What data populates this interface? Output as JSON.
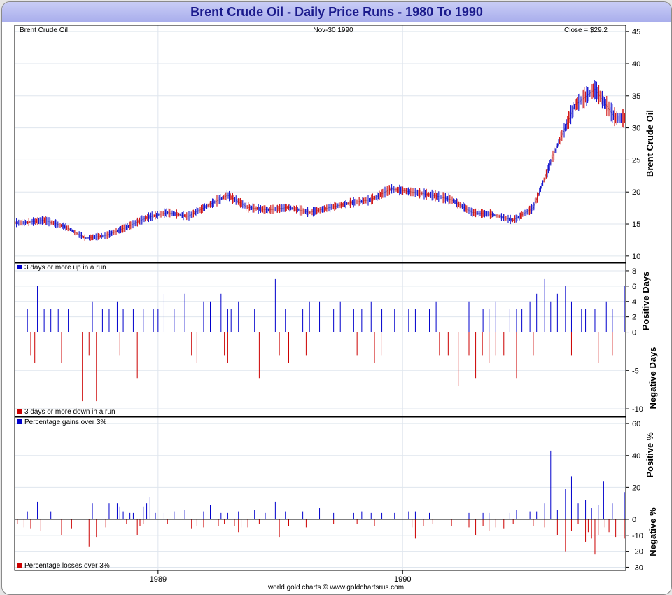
{
  "title": "Brent Crude Oil - Daily Price Runs - 1980 To 1990",
  "credit": "world gold charts © www.goldchartsrus.com",
  "colors": {
    "up": "#0000cc",
    "down": "#cc0000",
    "grid": "#dfe6ee"
  },
  "chart_data": [
    {
      "type": "line",
      "panel": "price",
      "header_left": "Brent Crude Oil",
      "header_center": "Nov-30  1990",
      "header_right": "Close = $29.2",
      "ylabel": "Brent Crude Oil",
      "ylim": [
        9,
        46
      ],
      "yticks": [
        "10",
        "15",
        "20",
        "25",
        "30",
        "35",
        "40",
        "45"
      ],
      "xticks": [
        "1989",
        "1990"
      ],
      "x_start": "1988-06-01",
      "x_end": "1990-11-30",
      "series": [
        {
          "x": [
            "1988-06",
            "1988-07",
            "1988-08",
            "1988-09",
            "1988-10",
            "1988-11",
            "1988-12",
            "1989-01",
            "1989-02",
            "1989-03",
            "1989-04",
            "1989-05",
            "1989-06",
            "1989-07",
            "1989-08",
            "1989-09",
            "1989-10",
            "1989-11",
            "1989-12",
            "1990-01",
            "1990-02",
            "1990-03",
            "1990-04",
            "1990-05",
            "1990-06",
            "1990-07",
            "1990-08",
            "1990-09",
            "1990-10",
            "1990-11"
          ],
          "values": [
            15.2,
            15.6,
            14.6,
            12.8,
            13.2,
            14.5,
            16.0,
            16.8,
            16.2,
            17.8,
            19.5,
            17.6,
            17.2,
            17.6,
            16.8,
            17.6,
            18.3,
            18.8,
            20.5,
            20.0,
            19.5,
            18.8,
            16.8,
            16.5,
            15.6,
            17.5,
            26.0,
            33.5,
            36.0,
            31.5
          ]
        }
      ]
    },
    {
      "type": "bar",
      "panel": "runs",
      "legend_top": "3 days or more up in a run",
      "legend_bottom": "3 days or more down in a run",
      "ylabel_top": "Positive Days",
      "ylabel_bottom": "Negative Days",
      "ylim": [
        -11,
        9
      ],
      "yticks": [
        "8",
        "6",
        "4",
        "2",
        "0",
        "-5",
        "-10"
      ],
      "series": [
        {
          "name": "3 days or more up in a run",
          "x": [
            "1988-06-20",
            "1988-07-05",
            "1988-07-15",
            "1988-07-25",
            "1988-08-05",
            "1988-08-20",
            "1988-09-25",
            "1988-10-10",
            "1988-10-20",
            "1988-11-01",
            "1988-11-10",
            "1988-11-25",
            "1988-12-10",
            "1988-12-25",
            "1989-01-01",
            "1989-01-10",
            "1989-01-25",
            "1989-02-10",
            "1989-03-10",
            "1989-03-20",
            "1989-04-05",
            "1989-04-15",
            "1989-04-20",
            "1989-05-01",
            "1989-05-25",
            "1989-06-25",
            "1989-07-10",
            "1989-08-05",
            "1989-08-15",
            "1989-08-30",
            "1989-09-20",
            "1989-09-30",
            "1989-10-20",
            "1989-11-01",
            "1989-11-15",
            "1989-12-01",
            "1989-12-20",
            "1990-01-10",
            "1990-01-20",
            "1990-02-10",
            "1990-02-20",
            "1990-04-10",
            "1990-05-01",
            "1990-05-10",
            "1990-05-20",
            "1990-06-10",
            "1990-06-20",
            "1990-06-28",
            "1990-07-10",
            "1990-07-20",
            "1990-08-01",
            "1990-08-10",
            "1990-08-20",
            "1990-09-01",
            "1990-09-10",
            "1990-09-25",
            "1990-10-01",
            "1990-10-15",
            "1990-11-01",
            "1990-11-10",
            "1990-11-28"
          ],
          "values": [
            3,
            6,
            3,
            3,
            3,
            3,
            4,
            3,
            3,
            4,
            3,
            3,
            3,
            3,
            3,
            5,
            3,
            5,
            4,
            4,
            5,
            3,
            3,
            4,
            3,
            7,
            3,
            3,
            4,
            4,
            3,
            4,
            3,
            3,
            4,
            3,
            3,
            3,
            3,
            3,
            4,
            4,
            3,
            3,
            4,
            3,
            3,
            3,
            4,
            5,
            7,
            4,
            5,
            6,
            4,
            3,
            3,
            3,
            4,
            3,
            6
          ]
        },
        {
          "name": "3 days or more down in a run",
          "x": [
            "1988-06-25",
            "1988-07-01",
            "1988-08-10",
            "1988-09-10",
            "1988-09-20",
            "1988-10-01",
            "1988-11-05",
            "1988-12-01",
            "1989-02-20",
            "1989-02-28",
            "1989-04-10",
            "1989-04-15",
            "1989-06-01",
            "1989-07-01",
            "1989-07-15",
            "1989-08-10",
            "1989-10-25",
            "1989-11-20",
            "1989-11-30",
            "1990-02-25",
            "1990-03-10",
            "1990-03-25",
            "1990-04-10",
            "1990-04-20",
            "1990-04-30",
            "1990-05-10",
            "1990-05-20",
            "1990-06-01",
            "1990-06-20",
            "1990-07-01",
            "1990-07-15",
            "1990-09-10",
            "1990-10-20",
            "1990-11-10"
          ],
          "values": [
            -3,
            -4,
            -4,
            -9,
            -3,
            -9,
            -3,
            -6,
            -3,
            -4,
            -3,
            -4,
            -6,
            -3,
            -4,
            -3,
            -3,
            -4,
            -3,
            -3,
            -3,
            -7,
            -3,
            -6,
            -3,
            -4,
            -3,
            -3,
            -6,
            -3,
            -3,
            -3,
            -4,
            -3
          ]
        }
      ]
    },
    {
      "type": "bar",
      "panel": "percent",
      "legend_top": "Percentage gains over 3%",
      "legend_bottom": "Percentage losses over 3%",
      "ylabel_top": "Positive %",
      "ylabel_bottom": "Negative %",
      "ylim": [
        -32,
        64
      ],
      "yticks": [
        "60",
        "40",
        "20",
        "0",
        "-10",
        "-20",
        "-30"
      ],
      "series": [
        {
          "name": "Percentage gains over 3%",
          "x": [
            "1988-06-20",
            "1988-07-05",
            "1988-07-25",
            "1988-09-25",
            "1988-10-20",
            "1988-11-01",
            "1988-11-05",
            "1988-11-10",
            "1988-11-20",
            "1988-11-25",
            "1988-12-10",
            "1988-12-15",
            "1988-12-20",
            "1988-12-28",
            "1989-01-10",
            "1989-01-25",
            "1989-02-10",
            "1989-03-10",
            "1989-03-20",
            "1989-04-05",
            "1989-04-15",
            "1989-05-01",
            "1989-05-25",
            "1989-06-10",
            "1989-06-25",
            "1989-07-10",
            "1989-08-05",
            "1989-08-30",
            "1989-09-20",
            "1989-10-20",
            "1989-11-01",
            "1989-11-15",
            "1989-12-01",
            "1989-12-20",
            "1990-01-10",
            "1990-01-20",
            "1990-02-10",
            "1990-04-10",
            "1990-05-01",
            "1990-05-10",
            "1990-06-10",
            "1990-06-20",
            "1990-07-01",
            "1990-07-10",
            "1990-07-20",
            "1990-08-01",
            "1990-08-10",
            "1990-08-20",
            "1990-09-01",
            "1990-09-10",
            "1990-09-20",
            "1990-10-01",
            "1990-10-10",
            "1990-10-20",
            "1990-10-28",
            "1990-11-10",
            "1990-11-28"
          ],
          "values": [
            5,
            11,
            5,
            10,
            10,
            10,
            8,
            5,
            4,
            4,
            8,
            10,
            14,
            4,
            4,
            5,
            6,
            5,
            9,
            4,
            4,
            5,
            6,
            4,
            11,
            5,
            5,
            7,
            4,
            4,
            5,
            4,
            4,
            4,
            5,
            5,
            4,
            4,
            4,
            4,
            4,
            6,
            9,
            5,
            5,
            10,
            43,
            6,
            19,
            27,
            10,
            12,
            7,
            9,
            24,
            10,
            17
          ]
        },
        {
          "name": "Percentage losses over 3%",
          "x": [
            "1988-06-05",
            "1988-06-15",
            "1988-06-25",
            "1988-07-10",
            "1988-08-10",
            "1988-08-25",
            "1988-09-20",
            "1988-10-01",
            "1988-10-15",
            "1988-11-15",
            "1988-12-01",
            "1988-12-05",
            "1988-12-10",
            "1989-01-15",
            "1989-02-20",
            "1989-02-28",
            "1989-03-10",
            "1989-04-01",
            "1989-04-10",
            "1989-04-25",
            "1989-05-01",
            "1989-05-05",
            "1989-05-15",
            "1989-06-01",
            "1989-07-01",
            "1989-07-15",
            "1989-08-10",
            "1989-09-20",
            "1989-10-25",
            "1989-11-20",
            "1990-01-15",
            "1990-01-20",
            "1990-02-01",
            "1990-02-15",
            "1990-03-15",
            "1990-04-10",
            "1990-04-20",
            "1990-05-01",
            "1990-05-10",
            "1990-05-20",
            "1990-06-01",
            "1990-06-15",
            "1990-07-01",
            "1990-07-15",
            "1990-08-01",
            "1990-08-20",
            "1990-09-01",
            "1990-09-10",
            "1990-09-20",
            "1990-10-01",
            "1990-10-05",
            "1990-10-10",
            "1990-10-15",
            "1990-10-20",
            "1990-10-30",
            "1990-11-05",
            "1990-11-15",
            "1990-11-28"
          ],
          "values": [
            -3,
            -5,
            -6,
            -7,
            -10,
            -6,
            -17,
            -11,
            -5,
            -3,
            -10,
            -4,
            -3,
            -3,
            -6,
            -4,
            -5,
            -4,
            -3,
            -4,
            -8,
            -5,
            -5,
            -3,
            -11,
            -4,
            -5,
            -3,
            -3,
            -4,
            -5,
            -12,
            -4,
            -3,
            -4,
            -5,
            -10,
            -4,
            -7,
            -5,
            -6,
            -3,
            -6,
            -4,
            -5,
            -10,
            -20,
            -7,
            -3,
            -14,
            -8,
            -12,
            -22,
            -10,
            -5,
            -8,
            -11,
            -12
          ]
        }
      ]
    }
  ]
}
